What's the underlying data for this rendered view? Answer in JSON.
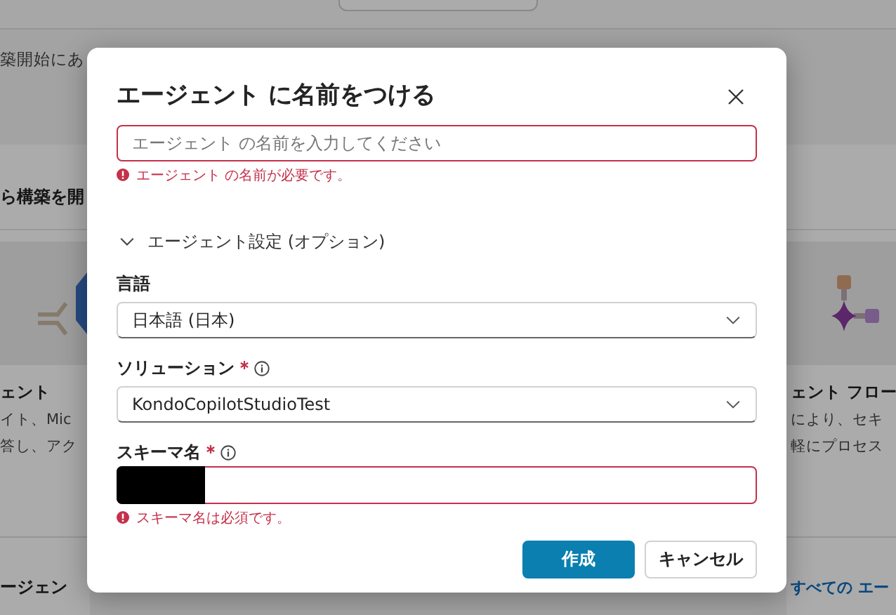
{
  "background": {
    "intro_fragment": "築開始にあ",
    "section_heading_fragment": "ら構築を開",
    "cards": [
      {
        "title": "ェント",
        "lines": [
          "イト、Mic",
          "答し、アク"
        ],
        "kind": "agent"
      },
      {
        "title": "ェント フロー",
        "lines": [
          "により、セキ",
          "軽にプロセス"
        ],
        "kind": "flow"
      }
    ],
    "footer_left": "ージェン",
    "footer_link": "すべての エー"
  },
  "dialog": {
    "title": "エージェント に名前をつける",
    "name_field": {
      "placeholder": "エージェント の名前を入力してください",
      "error": "エージェント の名前が必要です。"
    },
    "settings_toggle": {
      "label": "エージェント設定 (オプション)",
      "expanded": true
    },
    "fields": [
      {
        "label": "言語",
        "kind": "select",
        "value": "日本語 (日本)"
      },
      {
        "label": "ソリューション",
        "required": true,
        "info": true,
        "kind": "select",
        "value": "KondoCopilotStudioTest"
      },
      {
        "label": "スキーマ名",
        "required": true,
        "info": true,
        "kind": "text",
        "redacted": true,
        "error": "スキーマ名は必須です。"
      }
    ],
    "buttons": [
      {
        "label": "作成",
        "kind": "primary"
      },
      {
        "label": "キャンセル",
        "kind": "secondary"
      }
    ]
  }
}
